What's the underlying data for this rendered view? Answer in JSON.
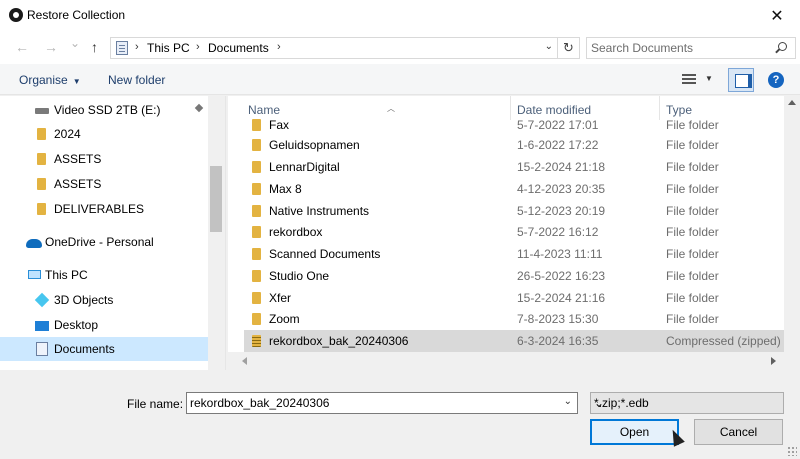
{
  "window": {
    "title": "Restore Collection",
    "close_glyph": "✕"
  },
  "nav": {
    "back_glyph": "←",
    "forward_glyph": "→",
    "recent_glyph": "⌄",
    "up_glyph": "↑",
    "breadcrumb": [
      "This PC",
      "Documents"
    ],
    "refresh_glyph": "↻"
  },
  "search": {
    "placeholder": "Search Documents"
  },
  "toolbar": {
    "organise_label": "Organise",
    "new_folder_label": "New folder",
    "help_glyph": "?"
  },
  "sidebar": {
    "items": [
      {
        "label": "Video SSD 2TB (E:)",
        "icon": "drive-icon",
        "pinned": true
      },
      {
        "label": "2024",
        "icon": "folder-icon"
      },
      {
        "label": "ASSETS",
        "icon": "folder-icon"
      },
      {
        "label": "ASSETS",
        "icon": "folder-icon"
      },
      {
        "label": "DELIVERABLES",
        "icon": "folder-icon"
      },
      {
        "label": "OneDrive - Personal",
        "icon": "cloud-icon"
      },
      {
        "label": "This PC",
        "icon": "computer-icon"
      },
      {
        "label": "3D Objects",
        "icon": "cube-icon"
      },
      {
        "label": "Desktop",
        "icon": "desktop-icon"
      },
      {
        "label": "Documents",
        "icon": "documents-icon",
        "selected": true
      }
    ]
  },
  "columns": {
    "name": "Name",
    "date": "Date modified",
    "type": "Type"
  },
  "files": [
    {
      "name": "Fax",
      "date": "5-7-2022 17:01",
      "type": "File folder"
    },
    {
      "name": "Geluidsopnamen",
      "date": "1-6-2022 17:22",
      "type": "File folder"
    },
    {
      "name": "LennarDigital",
      "date": "15-2-2024 21:18",
      "type": "File folder"
    },
    {
      "name": "Max 8",
      "date": "4-12-2023 20:35",
      "type": "File folder"
    },
    {
      "name": "Native Instruments",
      "date": "5-12-2023 20:19",
      "type": "File folder"
    },
    {
      "name": "rekordbox",
      "date": "5-7-2022 16:12",
      "type": "File folder"
    },
    {
      "name": "Scanned Documents",
      "date": "11-4-2023 11:11",
      "type": "File folder"
    },
    {
      "name": "Studio One",
      "date": "26-5-2022 16:23",
      "type": "File folder"
    },
    {
      "name": "Xfer",
      "date": "15-2-2024 21:16",
      "type": "File folder"
    },
    {
      "name": "Zoom",
      "date": "7-8-2023 15:30",
      "type": "File folder"
    },
    {
      "name": "rekordbox_bak_20240306",
      "date": "6-3-2024 16:35",
      "type": "Compressed (zipped) Folder",
      "selected": true
    }
  ],
  "footer": {
    "filename_label": "File name:",
    "filename_value": "rekordbox_bak_20240306",
    "filetype_value": "*.zip;*.edb",
    "open_label": "Open",
    "cancel_label": "Cancel"
  },
  "colors": {
    "accent": "#0078d7",
    "selection": "#cce8ff",
    "link": "#1e3e6c"
  }
}
